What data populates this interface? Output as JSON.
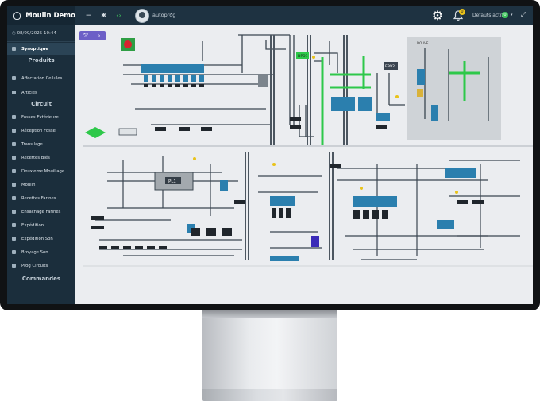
{
  "app": {
    "name": "Moulin Demo"
  },
  "header": {
    "user": "autoprog",
    "alarms_label": "Défauts actifs",
    "alarms_count": "0",
    "notifications_count": "0"
  },
  "sidebar": {
    "datetime": "08/09/2025 10:44",
    "sections": {
      "produits": "Produits",
      "circuit": "Circuit",
      "commandes": "Commandes"
    },
    "items": [
      {
        "label": "Synoptique"
      },
      {
        "label": "Affectation Cellules"
      },
      {
        "label": "Articles"
      },
      {
        "label": "Fosses Extérieure"
      },
      {
        "label": "Réception Fosse"
      },
      {
        "label": "Transilage"
      },
      {
        "label": "Recettes Blés"
      },
      {
        "label": "Deuxieme Mouillage"
      },
      {
        "label": "Moulin"
      },
      {
        "label": "Recettes Farines"
      },
      {
        "label": "Ensachage Farines"
      },
      {
        "label": "Expédition"
      },
      {
        "label": "Expédition Son"
      },
      {
        "label": "Broyage Son"
      },
      {
        "label": "Prog Circuits"
      }
    ]
  },
  "synoptic": {
    "labels": {
      "pl1": "PL1",
      "dpo1": "DPO1",
      "epo2": "EPO2",
      "douve": "DOUVE"
    }
  },
  "colors": {
    "topbar": "#1e3241",
    "sidebar": "#1b2e3c",
    "accent": "#6c5fc7",
    "equipment_blue": "#2b7fae",
    "running_green": "#2ec84a",
    "alarm_red": "#d8242f"
  }
}
